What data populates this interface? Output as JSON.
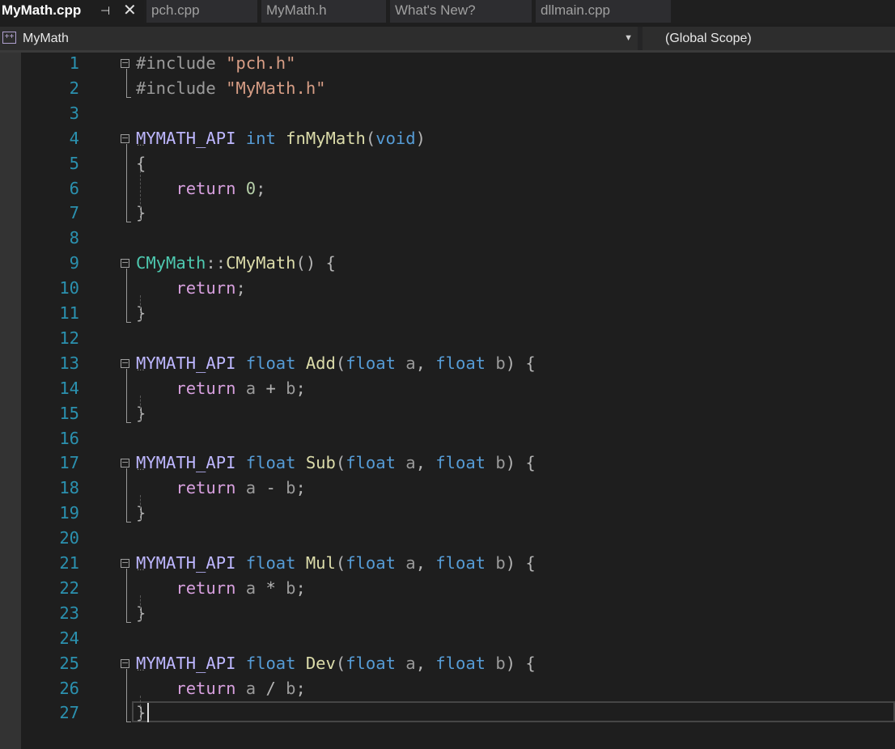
{
  "tabs": [
    {
      "label": "MyMath.cpp",
      "active": true,
      "pin_icon": "pin-icon",
      "close_icon": "close-icon"
    },
    {
      "label": "pch.cpp",
      "active": false
    },
    {
      "label": "MyMath.h",
      "active": false
    },
    {
      "label": "What's New?",
      "active": false
    },
    {
      "label": "dllmain.cpp",
      "active": false
    }
  ],
  "navbar": {
    "project_icon": "cpp-project-icon",
    "project": "MyMath",
    "dropdown_icon": "chevron-down-icon",
    "scope": "(Global Scope)"
  },
  "code_lines": [
    {
      "num": "1",
      "tokens": [
        [
          "pp",
          "#include "
        ],
        [
          "str",
          "\"pch.h\""
        ]
      ]
    },
    {
      "num": "2",
      "tokens": [
        [
          "pp",
          "#include "
        ],
        [
          "str",
          "\"MyMath.h\""
        ]
      ]
    },
    {
      "num": "3",
      "tokens": []
    },
    {
      "num": "4",
      "tokens": [
        [
          "mac",
          "MYMATH_API"
        ],
        [
          "pun",
          " "
        ],
        [
          "kw",
          "int"
        ],
        [
          "pun",
          " "
        ],
        [
          "fn",
          "fnMyMath"
        ],
        [
          "pun",
          "("
        ],
        [
          "kw",
          "void"
        ],
        [
          "pun",
          ")"
        ]
      ]
    },
    {
      "num": "5",
      "tokens": [
        [
          "pun",
          "{"
        ]
      ]
    },
    {
      "num": "6",
      "tokens": [
        [
          "pun",
          "    "
        ],
        [
          "ctl",
          "return"
        ],
        [
          "pun",
          " "
        ],
        [
          "num",
          "0"
        ],
        [
          "pun",
          ";"
        ]
      ]
    },
    {
      "num": "7",
      "tokens": [
        [
          "pun",
          "}"
        ]
      ]
    },
    {
      "num": "8",
      "tokens": []
    },
    {
      "num": "9",
      "tokens": [
        [
          "ty",
          "CMyMath"
        ],
        [
          "pun",
          "::"
        ],
        [
          "fn",
          "CMyMath"
        ],
        [
          "pun",
          "() {"
        ]
      ]
    },
    {
      "num": "10",
      "tokens": [
        [
          "pun",
          "    "
        ],
        [
          "ctl",
          "return"
        ],
        [
          "pun",
          ";"
        ]
      ]
    },
    {
      "num": "11",
      "tokens": [
        [
          "pun",
          "}"
        ]
      ]
    },
    {
      "num": "12",
      "tokens": []
    },
    {
      "num": "13",
      "tokens": [
        [
          "mac",
          "MYMATH_API"
        ],
        [
          "pun",
          " "
        ],
        [
          "kw",
          "float"
        ],
        [
          "pun",
          " "
        ],
        [
          "fn",
          "Add"
        ],
        [
          "pun",
          "("
        ],
        [
          "kw",
          "float"
        ],
        [
          "pun",
          " "
        ],
        [
          "par",
          "a"
        ],
        [
          "pun",
          ", "
        ],
        [
          "kw",
          "float"
        ],
        [
          "pun",
          " "
        ],
        [
          "par",
          "b"
        ],
        [
          "pun",
          ") {"
        ]
      ]
    },
    {
      "num": "14",
      "tokens": [
        [
          "pun",
          "    "
        ],
        [
          "ctl",
          "return"
        ],
        [
          "pun",
          " "
        ],
        [
          "par",
          "a"
        ],
        [
          "pun",
          " + "
        ],
        [
          "par",
          "b"
        ],
        [
          "pun",
          ";"
        ]
      ]
    },
    {
      "num": "15",
      "tokens": [
        [
          "pun",
          "}"
        ]
      ]
    },
    {
      "num": "16",
      "tokens": []
    },
    {
      "num": "17",
      "tokens": [
        [
          "mac",
          "MYMATH_API"
        ],
        [
          "pun",
          " "
        ],
        [
          "kw",
          "float"
        ],
        [
          "pun",
          " "
        ],
        [
          "fn",
          "Sub"
        ],
        [
          "pun",
          "("
        ],
        [
          "kw",
          "float"
        ],
        [
          "pun",
          " "
        ],
        [
          "par",
          "a"
        ],
        [
          "pun",
          ", "
        ],
        [
          "kw",
          "float"
        ],
        [
          "pun",
          " "
        ],
        [
          "par",
          "b"
        ],
        [
          "pun",
          ") {"
        ]
      ]
    },
    {
      "num": "18",
      "tokens": [
        [
          "pun",
          "    "
        ],
        [
          "ctl",
          "return"
        ],
        [
          "pun",
          " "
        ],
        [
          "par",
          "a"
        ],
        [
          "pun",
          " - "
        ],
        [
          "par",
          "b"
        ],
        [
          "pun",
          ";"
        ]
      ]
    },
    {
      "num": "19",
      "tokens": [
        [
          "pun",
          "}"
        ]
      ]
    },
    {
      "num": "20",
      "tokens": []
    },
    {
      "num": "21",
      "tokens": [
        [
          "mac",
          "MYMATH_API"
        ],
        [
          "pun",
          " "
        ],
        [
          "kw",
          "float"
        ],
        [
          "pun",
          " "
        ],
        [
          "fn",
          "Mul"
        ],
        [
          "pun",
          "("
        ],
        [
          "kw",
          "float"
        ],
        [
          "pun",
          " "
        ],
        [
          "par",
          "a"
        ],
        [
          "pun",
          ", "
        ],
        [
          "kw",
          "float"
        ],
        [
          "pun",
          " "
        ],
        [
          "par",
          "b"
        ],
        [
          "pun",
          ") {"
        ]
      ]
    },
    {
      "num": "22",
      "tokens": [
        [
          "pun",
          "    "
        ],
        [
          "ctl",
          "return"
        ],
        [
          "pun",
          " "
        ],
        [
          "par",
          "a"
        ],
        [
          "pun",
          " * "
        ],
        [
          "par",
          "b"
        ],
        [
          "pun",
          ";"
        ]
      ]
    },
    {
      "num": "23",
      "tokens": [
        [
          "pun",
          "}"
        ]
      ]
    },
    {
      "num": "24",
      "tokens": []
    },
    {
      "num": "25",
      "tokens": [
        [
          "mac",
          "MYMATH_API"
        ],
        [
          "pun",
          " "
        ],
        [
          "kw",
          "float"
        ],
        [
          "pun",
          " "
        ],
        [
          "fn",
          "Dev"
        ],
        [
          "pun",
          "("
        ],
        [
          "kw",
          "float"
        ],
        [
          "pun",
          " "
        ],
        [
          "par",
          "a"
        ],
        [
          "pun",
          ", "
        ],
        [
          "kw",
          "float"
        ],
        [
          "pun",
          " "
        ],
        [
          "par",
          "b"
        ],
        [
          "pun",
          ") {"
        ]
      ]
    },
    {
      "num": "26",
      "tokens": [
        [
          "pun",
          "    "
        ],
        [
          "ctl",
          "return"
        ],
        [
          "pun",
          " "
        ],
        [
          "par",
          "a"
        ],
        [
          "pun",
          " / "
        ],
        [
          "par",
          "b"
        ],
        [
          "pun",
          ";"
        ]
      ]
    },
    {
      "num": "27",
      "tokens": [
        [
          "pun",
          "}"
        ]
      ]
    }
  ],
  "folds": [
    {
      "start": 1,
      "end": 2,
      "dots": false
    },
    {
      "start": 4,
      "end": 7,
      "dots": true
    },
    {
      "start": 9,
      "end": 11,
      "dots": false
    },
    {
      "start": 13,
      "end": 15,
      "dots": true
    },
    {
      "start": 17,
      "end": 19,
      "dots": true
    },
    {
      "start": 21,
      "end": 23,
      "dots": true
    },
    {
      "start": 25,
      "end": 27,
      "dots": true
    }
  ],
  "caret_line": "27"
}
